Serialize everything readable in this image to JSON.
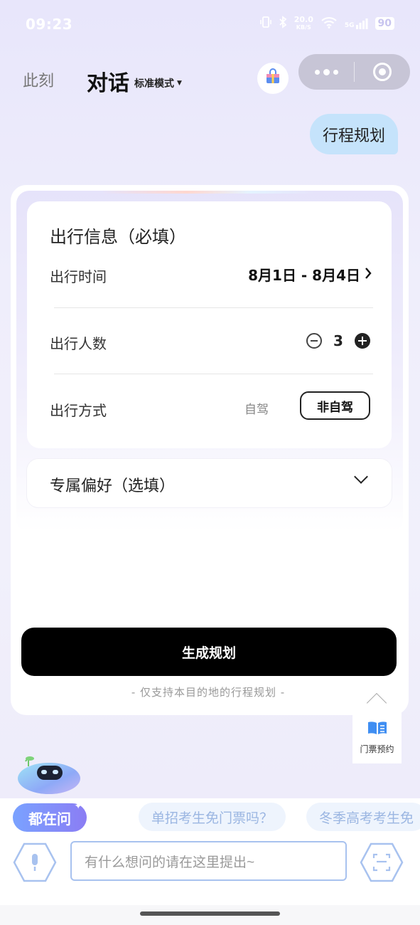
{
  "status_bar": {
    "time": "09:23",
    "net_speed_top": "20.0",
    "net_speed_unit": "KB/S",
    "signal_label": "5G",
    "battery": "90"
  },
  "header": {
    "nav_now": "此刻",
    "nav_chat": "对话",
    "mode_label": "标准模式",
    "gift_icon": "gift-bag-icon",
    "menu_icon": "more-dots-icon",
    "close_icon": "target-close-icon"
  },
  "chat": {
    "user_message": "行程规划"
  },
  "trip_card": {
    "info_title": "出行信息（必填）",
    "time_label": "出行时间",
    "time_value": "8月1日 - 8月4日",
    "people_label": "出行人数",
    "people_count": "3",
    "mode_label": "出行方式",
    "mode_self_drive": "自驾",
    "mode_non_self_drive": "非自驾",
    "preference_title": "专属偏好（选填）",
    "generate_button": "生成规划",
    "note": "- 仅支持本目的地的行程规划 -"
  },
  "floating": {
    "ticket_label": "门票预约",
    "ticket_icon": "ticket-book-icon"
  },
  "quick_questions": {
    "tag": "都在问",
    "items": [
      "吗？",
      "单招考生免门票吗？",
      "冬季高考考生免"
    ]
  },
  "input": {
    "placeholder": "有什么想问的请在这里提出~",
    "voice_icon": "microphone-icon",
    "camera_icon": "camera-scan-icon"
  },
  "colors": {
    "accent_blue": "#a8c2ef",
    "bubble_blue": "#c5e3fb",
    "primary_black": "#000000"
  }
}
